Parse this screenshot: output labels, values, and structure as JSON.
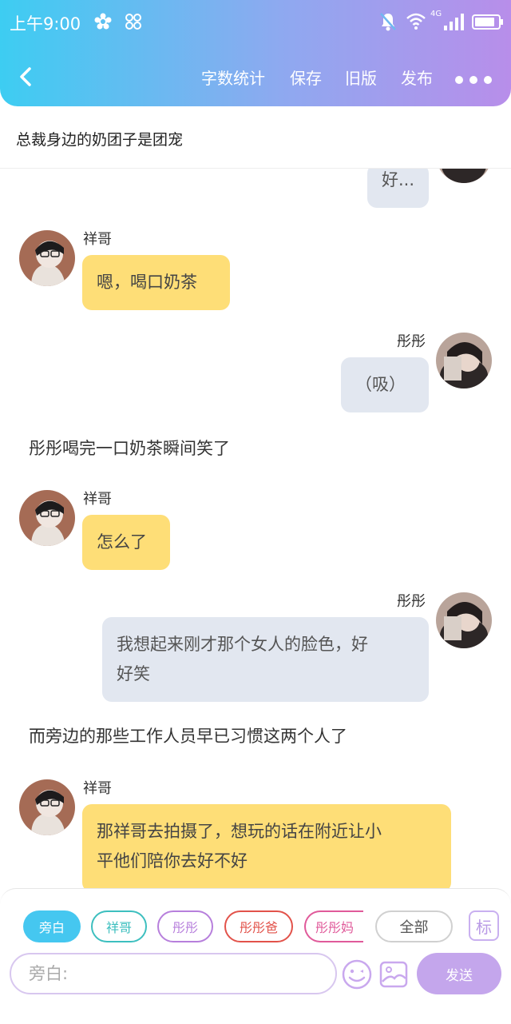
{
  "status_bar": {
    "time": "上午9:00",
    "network": "4G"
  },
  "toolbar": {
    "word_count": "字数统计",
    "save": "保存",
    "old_version": "旧版",
    "publish": "发布"
  },
  "story_title": "总裁身边的奶团子是团宠",
  "messages": [
    {
      "type": "right",
      "speaker": "",
      "text": "好..."
    },
    {
      "type": "left",
      "speaker": "祥哥",
      "text": "嗯，喝口奶茶"
    },
    {
      "type": "right",
      "speaker": "彤彤",
      "text": "（吸）"
    },
    {
      "type": "narration",
      "text": "彤彤喝完一口奶茶瞬间笑了"
    },
    {
      "type": "left",
      "speaker": "祥哥",
      "text": "怎么了"
    },
    {
      "type": "right",
      "speaker": "彤彤",
      "text_line1": "我想起来刚才那个女人的脸色，好",
      "text_line2": "好笑"
    },
    {
      "type": "narration",
      "text": "而旁边的那些工作人员早已习惯这两个人了"
    },
    {
      "type": "left",
      "speaker": "祥哥",
      "text_line1": "那祥哥去拍摄了，想玩的话在附近让小",
      "text_line2": "平他们陪你去好不好"
    }
  ],
  "role_chips": [
    {
      "label": "旁白",
      "color": "#45c7f0",
      "selected": true
    },
    {
      "label": "祥哥",
      "color": "#3dbfbf",
      "selected": false
    },
    {
      "label": "彤彤",
      "color": "#b77fdc",
      "selected": false
    },
    {
      "label": "彤彤爸",
      "color": "#e2524a",
      "selected": false
    },
    {
      "label": "彤彤妈",
      "color": "#e05a9a",
      "selected": false
    },
    {
      "label": "全部",
      "color": "#cccccc",
      "selected": false
    }
  ],
  "tag_button": "标",
  "input": {
    "placeholder": "旁白:"
  },
  "send_label": "发送",
  "colors": {
    "yellow_bubble": "#fede77",
    "gray_bubble": "#e2e7f0",
    "send": "#c4a6ec"
  }
}
